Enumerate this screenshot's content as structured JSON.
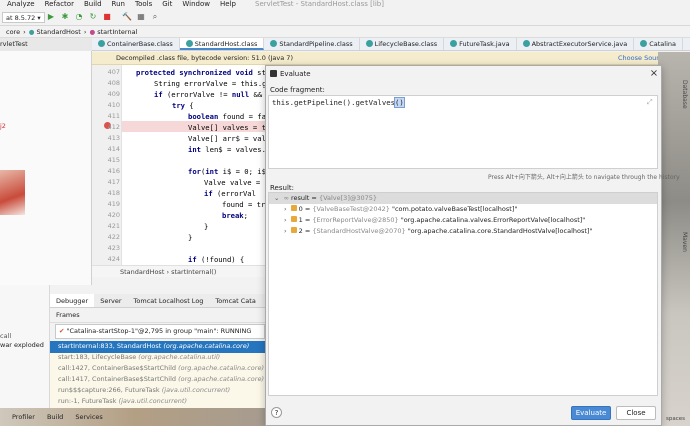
{
  "menu": [
    "Analyze",
    "Refactor",
    "Build",
    "Run",
    "Tools",
    "Git",
    "Window",
    "Help"
  ],
  "window_title": "ServletTest - StandardHost.class [lib]",
  "run_config": "at 8.5.72",
  "breadcrumbs": [
    "core",
    "StandardHost",
    "startInternal"
  ],
  "project_header": "rvletTest",
  "tabs": [
    "ContainerBase.class",
    "StandardHost.class",
    "StandardPipeline.class",
    "LifecycleBase.class",
    "FutureTask.java",
    "AbstractExecutorService.java",
    "Catalina"
  ],
  "banner": {
    "text": "Decompiled .class file, bytecode version: 51.0 (Java 7)",
    "link": "Choose Sources..."
  },
  "editor": {
    "line_numbers": [
      "407",
      "408",
      "409",
      "410",
      "411",
      "412",
      "413",
      "414",
      "415",
      "416",
      "417",
      "418",
      "419",
      "420",
      "421",
      "422",
      "423",
      "424"
    ],
    "lines": [
      "protected synchronized void st",
      "String errorValve = this.g",
      "if (errorValve != null &&",
      "try {",
      "boolean found = fa",
      "Valve[] valves = t",
      "Valve[] arr$ = val",
      "int len$ = valves.",
      "",
      "for(int i$ = 0; i$",
      "Valve valve =",
      "if (errorVal",
      "found = tr",
      "break;",
      "}",
      "}",
      "",
      "if (!found) {"
    ],
    "footer_crumbs": [
      "StandardHost",
      "startInternal()"
    ]
  },
  "debugger": {
    "tabs": [
      "Debugger",
      "Server",
      "Tomcat Localhost Log",
      "Tomcat Cata"
    ],
    "frames_label": "Frames",
    "thread": "\"Catalina-startStop-1\"@2,795 in group \"main\": RUNNING",
    "frames": [
      {
        "method": "startInternal:833, StandardHost",
        "cls": "(org.apache.catalina.core)"
      },
      {
        "method": "start:183, LifecycleBase",
        "cls": "(org.apache.catalina.util)"
      },
      {
        "method": "call:1427, ContainerBase$StartChild",
        "cls": "(org.apache.catalina.core)"
      },
      {
        "method": "call:1417, ContainerBase$StartChild",
        "cls": "(org.apache.catalina.core)"
      },
      {
        "method": "run$$$capture:266, FutureTask",
        "cls": "(java.util.concurrent)"
      },
      {
        "method": "run:-1, FutureTask",
        "cls": "(java.util.concurrent)"
      }
    ],
    "left_items": [
      "war exploded",
      "call"
    ],
    "status_items": [
      "Profiler",
      "Build",
      "Services"
    ]
  },
  "right_strip": [
    "Database",
    "Maven",
    "spaces"
  ],
  "dialog": {
    "title": "Evaluate",
    "code_fragment_label": "Code fragment:",
    "code": "this.getPipeline().getValves()",
    "hint": "Press Alt+向下箭头, Alt+向上箭头 to navigate through the history",
    "result_label": "Result:",
    "result_root": {
      "name": "result",
      "value": "{Valve[3]@3075}"
    },
    "result_items": [
      {
        "index": "0",
        "ref": "{ValveBaseTest@2042}",
        "value": "\"com.potato.valveBaseTest[localhost]\""
      },
      {
        "index": "1",
        "ref": "{ErrorReportValve@2850}",
        "value": "\"org.apache.catalina.valves.ErrorReportValve[localhost]\""
      },
      {
        "index": "2",
        "ref": "{StandardHostValve@2070}",
        "value": "\"org.apache.catalina.core.StandardHostValve[localhost]\""
      }
    ],
    "evaluate_label": "Evaluate",
    "close_label": "Close",
    "help_label": "?"
  }
}
